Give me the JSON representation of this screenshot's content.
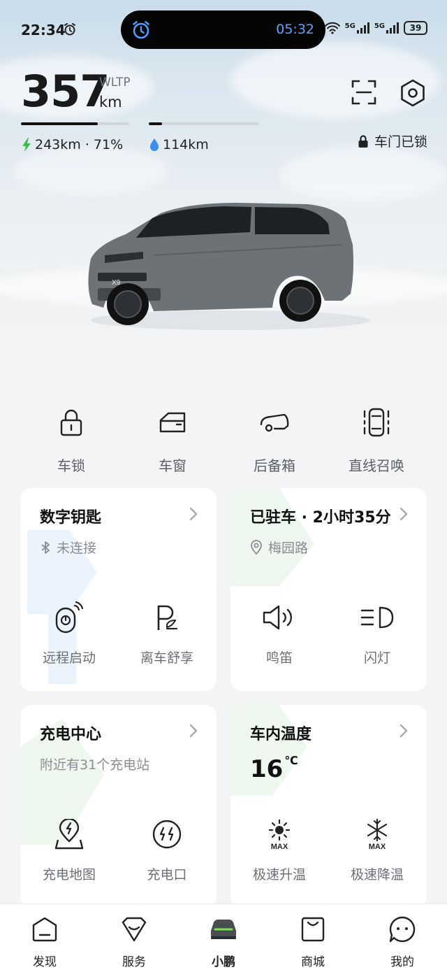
{
  "status_bar": {
    "time": "22:34",
    "island_time": "05:32",
    "network_1": "5G",
    "network_2": "5G",
    "battery": "39"
  },
  "range": {
    "value": "357",
    "standard": "WLTP",
    "unit": "km",
    "electric": "243km · 71%",
    "fuel": "114km",
    "electric_level": 0.71,
    "fuel_level": 0.12
  },
  "door_status": "车门已锁",
  "quick_actions": [
    {
      "label": "车锁",
      "icon": "lock-icon"
    },
    {
      "label": "车窗",
      "icon": "window-icon"
    },
    {
      "label": "后备箱",
      "icon": "trunk-icon"
    },
    {
      "label": "直线召唤",
      "icon": "summon-icon"
    }
  ],
  "cards": {
    "digital_key": {
      "title": "数字钥匙",
      "subtitle": "未连接",
      "actions": [
        {
          "label": "远程启动",
          "icon": "remote-start-icon"
        },
        {
          "label": "离车舒享",
          "icon": "parking-comfort-icon"
        }
      ]
    },
    "parked": {
      "title": "已驻车 · 2小时35分",
      "subtitle": "梅园路",
      "actions": [
        {
          "label": "鸣笛",
          "icon": "horn-icon"
        },
        {
          "label": "闪灯",
          "icon": "headlight-icon"
        }
      ]
    },
    "charging": {
      "title": "充电中心",
      "subtitle": "附近有31个充电站",
      "actions": [
        {
          "label": "充电地图",
          "icon": "charge-map-icon"
        },
        {
          "label": "充电口",
          "icon": "charge-port-icon"
        }
      ]
    },
    "climate": {
      "title": "车内温度",
      "temp_value": "16",
      "temp_unit": "℃",
      "max_badge": "MAX",
      "actions": [
        {
          "label": "极速升温",
          "icon": "heat-max-icon"
        },
        {
          "label": "极速降温",
          "icon": "cool-max-icon"
        }
      ]
    }
  },
  "car_badge": "X9",
  "bottom_nav": [
    {
      "label": "发现",
      "icon": "discover-icon"
    },
    {
      "label": "服务",
      "icon": "service-icon"
    },
    {
      "label": "小鹏",
      "icon": "car-icon",
      "active": true
    },
    {
      "label": "商城",
      "icon": "mall-icon"
    },
    {
      "label": "我的",
      "icon": "profile-icon"
    }
  ],
  "colors": {
    "accent_green": "#3dbb4e",
    "fuel_blue": "#3a8ef0",
    "island_time": "#5aa2ff",
    "active_nav_glow": "#7be34a"
  }
}
